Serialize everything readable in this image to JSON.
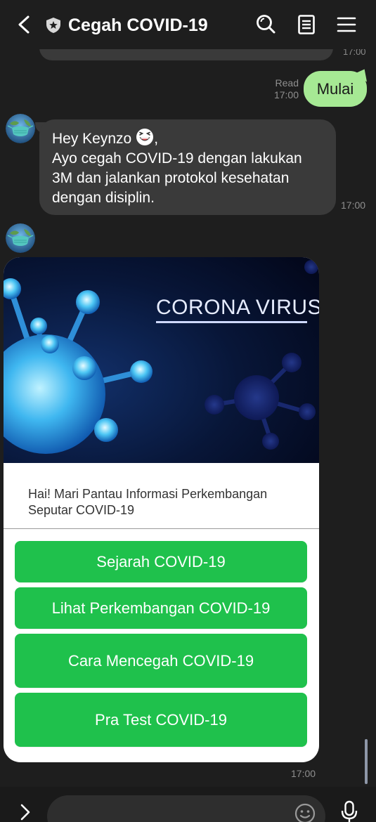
{
  "header": {
    "title": "Cegah COVID-19",
    "back_icon": "chevron-left-icon",
    "shield_icon": "shield-icon",
    "search_icon": "search-icon",
    "notes_icon": "notes-icon",
    "menu_icon": "hamburger-menu-icon"
  },
  "chat": {
    "previous_time": "17:00",
    "outgoing": {
      "text": "Mulai",
      "read_label": "Read",
      "time": "17:00"
    },
    "incoming_text": {
      "greeting": "Hey Keynzo",
      "greeting_suffix": ",",
      "body": "Ayo cegah COVID-19 dengan lakukan 3M dan jalankan protokol kesehatan dengan disiplin.",
      "time": "17:00"
    },
    "card": {
      "image_caption": "CORONA VIRUS",
      "text": "Hai! Mari Pantau Informasi Perkembangan Seputar COVID-19",
      "buttons": [
        {
          "label": "Sejarah COVID-19"
        },
        {
          "label": "Lihat Perkembangan COVID-19"
        },
        {
          "label": "Cara Mencegah COVID-19"
        },
        {
          "label": "Pra Test COVID-19"
        }
      ],
      "time": "17:00"
    }
  },
  "input": {
    "placeholder": "",
    "expand_icon": "chevron-right-icon",
    "emoji_icon": "smiley-icon",
    "mic_icon": "microphone-icon"
  },
  "colors": {
    "background": "#1e1e1e",
    "outgoing_bubble": "#a6e994",
    "incoming_bubble": "#3a3a3a",
    "button_green": "#1fc14c"
  }
}
